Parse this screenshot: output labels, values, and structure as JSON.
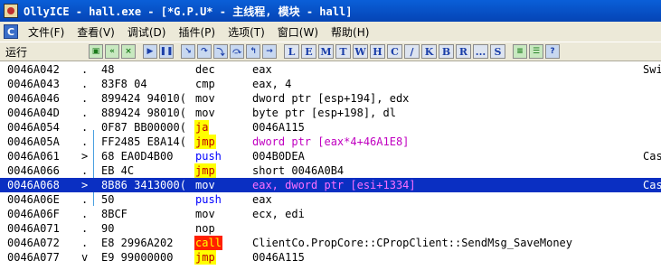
{
  "window": {
    "title": "OllyICE - hall.exe - [*G.P.U* -  主线程, 模块 - hall]"
  },
  "menu": {
    "sys_icon": "C",
    "items": [
      "文件(F)",
      "查看(V)",
      "调试(D)",
      "插件(P)",
      "选项(T)",
      "窗口(W)",
      "帮助(H)"
    ]
  },
  "toolbar": {
    "status": "运行",
    "icons": [
      "open-icon",
      "restart-icon",
      "close-icon",
      "run-icon",
      "pause-icon",
      "step-into-icon",
      "step-over-icon",
      "trace-into-icon",
      "trace-over-icon",
      "execute-till-return-icon",
      "goto-icon"
    ],
    "letters": [
      "L",
      "E",
      "M",
      "T",
      "W",
      "H",
      "C",
      "/",
      "K",
      "B",
      "R",
      "...",
      "S"
    ],
    "right_icons": [
      "list-icon",
      "options-icon",
      "help-icon"
    ]
  },
  "disasm": {
    "rows": [
      {
        "addr": "0046A042",
        "mark": ".",
        "hex": "48",
        "mn": "dec",
        "mn_type": "arith",
        "ops": "eax",
        "ops_type": "plain",
        "cmt": "Swi"
      },
      {
        "addr": "0046A043",
        "mark": ".",
        "hex": "83F8 04",
        "mn": "cmp",
        "mn_type": "arith",
        "ops": "eax, 4",
        "ops_type": "plain",
        "cmt": ""
      },
      {
        "addr": "0046A046",
        "mark": ".",
        "hex": "899424 94010(",
        "mn": "mov",
        "mn_type": "arith",
        "ops": "dword ptr [esp+194], edx",
        "ops_type": "plain",
        "cmt": ""
      },
      {
        "addr": "0046A04D",
        "mark": ".",
        "hex": "889424 98010(",
        "mn": "mov",
        "mn_type": "arith",
        "ops": "byte ptr [esp+198], dl",
        "ops_type": "plain",
        "cmt": ""
      },
      {
        "addr": "0046A054",
        "mark": ".",
        "hex": "0F87 BB00000(",
        "mn": "ja",
        "mn_type": "jump",
        "ops": "0046A115",
        "ops_type": "plain",
        "cmt": ""
      },
      {
        "addr": "0046A05A",
        "mark": ".",
        "hex": "FF2485 E8A14(",
        "mn": "jmp",
        "mn_type": "jump",
        "ops": "dword ptr [eax*4+46A1E8]",
        "ops_type": "mem",
        "cmt": ""
      },
      {
        "addr": "0046A061",
        "mark": ">",
        "hex": "68 EA0D4B00",
        "mn": "push",
        "mn_type": "stack",
        "ops": "004B0DEA",
        "ops_type": "plain",
        "cmt": "Cas"
      },
      {
        "addr": "0046A066",
        "mark": ".",
        "hex": "EB 4C",
        "mn": "jmp",
        "mn_type": "jump",
        "ops": "short 0046A0B4",
        "ops_type": "plain",
        "cmt": ""
      },
      {
        "addr": "0046A068",
        "mark": ">",
        "hex": "8B86 3413000(",
        "mn": "mov",
        "mn_type": "arith",
        "ops": "eax, dword ptr [esi+1334]",
        "ops_type": "selmem",
        "cmt": "Cas"
      },
      {
        "addr": "0046A06E",
        "mark": ".",
        "hex": "50",
        "mn": "push",
        "mn_type": "stack",
        "ops": "eax",
        "ops_type": "plain",
        "cmt": ""
      },
      {
        "addr": "0046A06F",
        "mark": ".",
        "hex": "8BCF",
        "mn": "mov",
        "mn_type": "arith",
        "ops": "ecx, edi",
        "ops_type": "plain",
        "cmt": ""
      },
      {
        "addr": "0046A071",
        "mark": ".",
        "hex": "90",
        "mn": "nop",
        "mn_type": "arith",
        "ops": "",
        "ops_type": "plain",
        "cmt": ""
      },
      {
        "addr": "0046A072",
        "mark": ".",
        "hex": "E8 2996A202",
        "mn": "call",
        "mn_type": "call",
        "ops": "ClientCo.PropCore::CPropClient::SendMsg_SaveMoney",
        "ops_type": "plain",
        "cmt": ""
      },
      {
        "addr": "0046A077",
        "mark": "v",
        "hex": "E9 99000000",
        "mn": "jmp",
        "mn_type": "jump",
        "ops": "0046A115",
        "ops_type": "plain",
        "cmt": ""
      }
    ],
    "selected_index": 8
  },
  "colors": {
    "selection": "#0a2fc2",
    "jump_bg": "#ffff00",
    "call_bg": "#ff2000",
    "push_fg": "#0000ff",
    "mem_fg": "#c000c0"
  }
}
